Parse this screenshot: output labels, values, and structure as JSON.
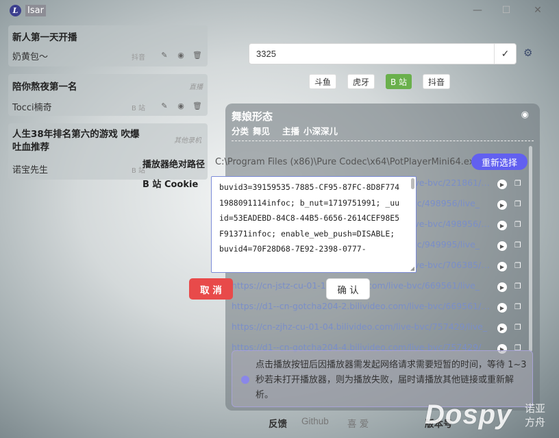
{
  "window": {
    "title": "Isar",
    "logo_letter": "L",
    "minimize": "—",
    "maximize": "☐",
    "close": "✕"
  },
  "rooms": [
    {
      "title": "新人第一天开播",
      "host": "奶黄包～",
      "platform": "抖音"
    },
    {
      "title": "陪你熬夜第一名",
      "host": "Tocci楠奇",
      "platform": "B 站",
      "status": "直播"
    },
    {
      "title": "人生38年排名第六的游戏 吹爆 吐血推荐",
      "host": "诺宝先生",
      "platform": "B 站",
      "status": "其他录机"
    }
  ],
  "search": {
    "value": "3325",
    "check_icon": "✓",
    "settings_icon": "⚙"
  },
  "platforms": [
    {
      "label": "斗鱼",
      "active": false
    },
    {
      "label": "虎牙",
      "active": false
    },
    {
      "label": "B 站",
      "active": true
    },
    {
      "label": "抖音",
      "active": false
    }
  ],
  "room_panel": {
    "title": "舞娘形态",
    "category_label": "分类",
    "category": "舞见",
    "host_label": "主播",
    "host": "小深深儿",
    "links": [
      "https://d1--cn-gotcha204-2.bilivideo.com/live-bvc/221861/live_",
      "https://cn-jstz-cu-01-1.bilivideo.com/live-bvc/498956/live_",
      "https://d1--cn-gotcha204-2.bilivideo.com/live-bvc/498956/live_",
      "https://cn-jstz-cu-01-2.bilivideo.com/live-bvc/949995/live_",
      "https://d1--cn-gotcha204-4.bilivideo.com/live-bvc/706385/live_",
      "https://cn-jstz-cu-01-1.bilivideo.com/live-bvc/669561/live_",
      "https://d1--cn-gotcha204-2.bilivideo.com/live-bvc/669561/live_",
      "https://cn-zjhz-cu-01-04.bilivideo.com/live-bvc/757429/live_",
      "https://d1--cn-gotcha204-4.bilivideo.com/live-bvc/757429/"
    ]
  },
  "notice": {
    "text": "点击播放按钮后因播放器需发起网络请求需要短暂的时间，等待 1~3 秒若未打开播放器，则为播放失败，届时请播放其他链接或重新解析。"
  },
  "footer": {
    "feedback": "反馈",
    "github": "Github",
    "donate": "喜 爱",
    "version": "版本号"
  },
  "watermark": {
    "brand": "Dospy",
    "line1": "诺亚",
    "line2": "方舟"
  },
  "dialog": {
    "player_path_label": "播放器绝对路径",
    "player_path": "C:\\Program Files (x86)\\Pure Codec\\x64\\PotPlayerMini64.exe",
    "reselect": "重新选择",
    "cookie_label": "B 站 Cookie",
    "cookie": "buvid3=39159535-7885-CF95-87FC-8D8F7741988091114infoc; b_nut=1719751991; _uuid=53EADEBD-84C8-44B5-6656-2614CEF98E5F91371infoc; enable_web_push=DISABLE; buvid4=70F28D68-7E92-2398-0777-",
    "cancel": "取 消",
    "confirm": "确 认"
  },
  "colors": {
    "accent": "#6260f0",
    "bilibili_active": "#6ab04c",
    "cancel": "#e84a4a"
  }
}
